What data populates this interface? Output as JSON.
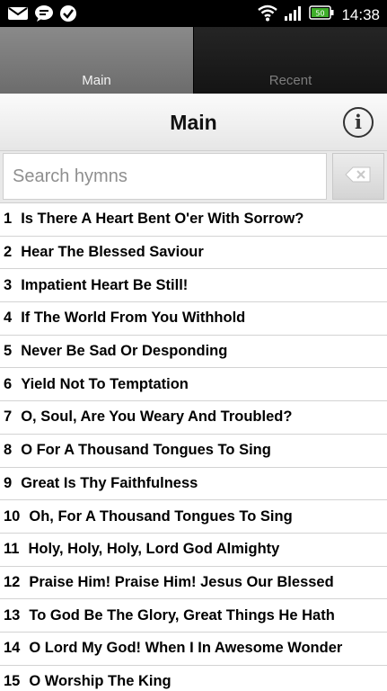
{
  "status_bar": {
    "time": "14:38",
    "battery": "50",
    "left_icons": [
      "mail-icon",
      "chat-icon",
      "check-icon"
    ],
    "right_icons": [
      "wifi-icon",
      "signal-icon",
      "battery-icon"
    ]
  },
  "tabs": [
    {
      "label": "Main",
      "active": true
    },
    {
      "label": "Recent",
      "active": false
    }
  ],
  "header": {
    "title": "Main",
    "info_icon": "info-icon"
  },
  "search": {
    "placeholder": "Search hymns",
    "value": "",
    "clear_icon": "clear-icon"
  },
  "hymns": [
    {
      "num": "1",
      "title": "Is There A Heart Bent O'er With Sorrow?"
    },
    {
      "num": "2",
      "title": "Hear The Blessed Saviour"
    },
    {
      "num": "3",
      "title": "Impatient Heart Be Still!"
    },
    {
      "num": "4",
      "title": "If The World From You Withhold"
    },
    {
      "num": "5",
      "title": "Never Be Sad Or Desponding"
    },
    {
      "num": "6",
      "title": "Yield Not To Temptation"
    },
    {
      "num": "7",
      "title": "O, Soul, Are You Weary And Troubled?"
    },
    {
      "num": "8",
      "title": "O For A Thousand Tongues To Sing"
    },
    {
      "num": "9",
      "title": "Great Is Thy Faithfulness"
    },
    {
      "num": "10",
      "title": "Oh, For A Thousand Tongues To Sing"
    },
    {
      "num": "11",
      "title": "Holy, Holy, Holy, Lord God Almighty"
    },
    {
      "num": "12",
      "title": "Praise Him! Praise Him! Jesus Our Blessed"
    },
    {
      "num": "13",
      "title": "To God Be The Glory, Great Things He Hath"
    },
    {
      "num": "14",
      "title": "O Lord My God! When I In Awesome Wonder"
    },
    {
      "num": "15",
      "title": "O Worship The King"
    }
  ]
}
